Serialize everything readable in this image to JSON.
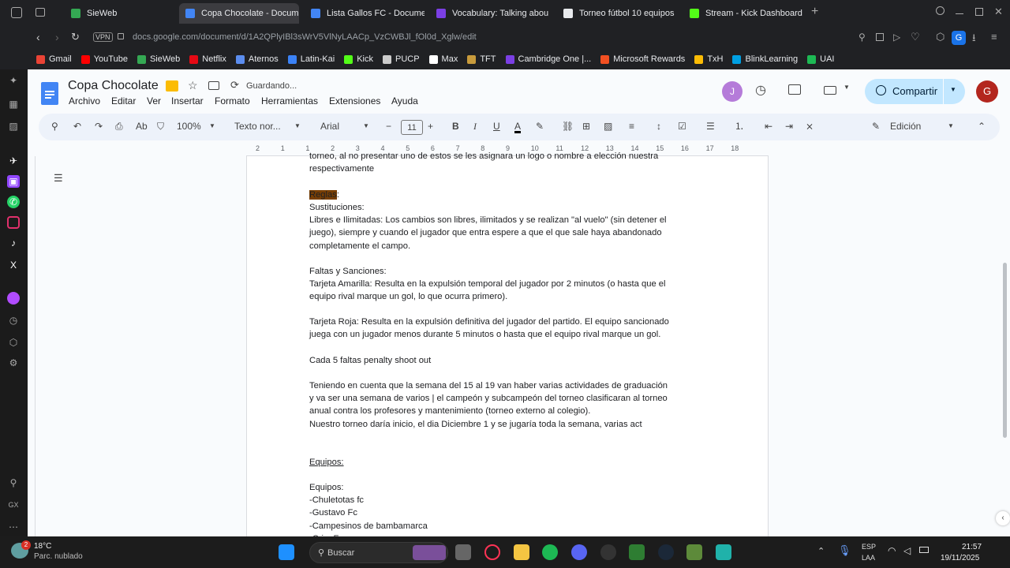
{
  "tabs": [
    {
      "label": "SieWeb",
      "color": "#34a853"
    },
    {
      "label": "Copa Chocolate - Docum",
      "color": "#4285f4",
      "active": true
    },
    {
      "label": "Lista Gallos FC - Docume",
      "color": "#4285f4"
    },
    {
      "label": "Vocabulary: Talking abou",
      "color": "#7b3fe4"
    },
    {
      "label": "Torneo fútbol 10 equipos",
      "color": "#e8eaed"
    },
    {
      "label": "Stream - Kick Dashboard",
      "color": "#53fc18"
    }
  ],
  "address": {
    "vpn": "VPN",
    "url": "docs.google.com/document/d/1A2QPlyIBl3sWrV5VlNyLAACp_VzCWBJl_fOl0d_Xglw/edit"
  },
  "bookmarks": [
    {
      "label": "Gmail",
      "color": "#ea4335"
    },
    {
      "label": "YouTube",
      "color": "#ff0000"
    },
    {
      "label": "SieWeb",
      "color": "#34a853"
    },
    {
      "label": "Netflix",
      "color": "#e50914"
    },
    {
      "label": "Aternos",
      "color": "#5b8def"
    },
    {
      "label": "Latin-Kai",
      "color": "#3b82f6"
    },
    {
      "label": "Kick",
      "color": "#53fc18"
    },
    {
      "label": "PUCP",
      "color": "#cccccc"
    },
    {
      "label": "Max",
      "color": "#ffffff"
    },
    {
      "label": "TFT",
      "color": "#c89b3c"
    },
    {
      "label": "Cambridge One |...",
      "color": "#7b3fe4"
    },
    {
      "label": "Microsoft Rewards",
      "color": "#f25022"
    },
    {
      "label": "TxH",
      "color": "#fbbc05"
    },
    {
      "label": "BlinkLearning",
      "color": "#00a0e3"
    },
    {
      "label": "UAI",
      "color": "#1db954"
    }
  ],
  "doc": {
    "title": "Copa Chocolate",
    "saving": "Guardando...",
    "menus": [
      "Archivo",
      "Editar",
      "Ver",
      "Insertar",
      "Formato",
      "Herramientas",
      "Extensiones",
      "Ayuda"
    ],
    "share": "Compartir",
    "avatar1": "J",
    "avatar2": "G",
    "zoom": "100%",
    "style": "Texto nor...",
    "font": "Arial",
    "fontsize": "11",
    "mode": "Edición"
  },
  "ruler": [
    "2",
    "1",
    "1",
    "2",
    "3",
    "4",
    "5",
    "6",
    "7",
    "8",
    "9",
    "10",
    "11",
    "12",
    "13",
    "14",
    "15",
    "16",
    "17",
    "18"
  ],
  "content": {
    "p0": "torneo, al no presentar uno de estos se les asignara un logo o nombre a elección nuestra\nrespectivamente",
    "reglas": "Reglas",
    "reglas_colon": ":",
    "p1": "Sustituciones:\nLibres e Ilimitadas: Los cambios son libres, ilimitados y se realizan \"al vuelo\" (sin detener el\njuego), siempre y cuando el jugador que entra espere a que el que sale haya abandonado\ncompletamente el campo.",
    "p2": "Faltas y Sanciones:\nTarjeta Amarilla: Resulta en la expulsión temporal del jugador por 2 minutos (o hasta que el\nequipo rival marque un gol, lo que ocurra primero).",
    "p3": "Tarjeta Roja: Resulta en la expulsión definitiva del jugador del partido. El equipo sancionado\njuega con un jugador menos durante 5 minutos o hasta que el equipo rival marque un gol.",
    "p4": "Cada 5 faltas penalty shoot out",
    "p5": "Teniendo en cuenta que la semana del 15 al 19 van haber varias actividades de graduación\ny va ser una semana de varios | el campeón y subcampeón del torneo clasificaran al torneo\nanual contra los profesores y mantenimiento (torneo externo al colegio).\nNuestro torneo daría inicio, el dia Diciembre 1 y se jugaría toda la semana, varias act",
    "equipos_h": "Equipos:",
    "p6": "Equipos:\n-Chuletotas fc\n-Gustavo Fc\n-Campesinos de bambamarca\n-Cri... F..."
  },
  "taskbar": {
    "weather_temp": "18°C",
    "weather_desc": "Parc. nublado",
    "search": "Buscar",
    "lang1": "ESP",
    "lang2": "LAA",
    "time": "21:57",
    "date": "19/11/2025",
    "notif": "2"
  }
}
